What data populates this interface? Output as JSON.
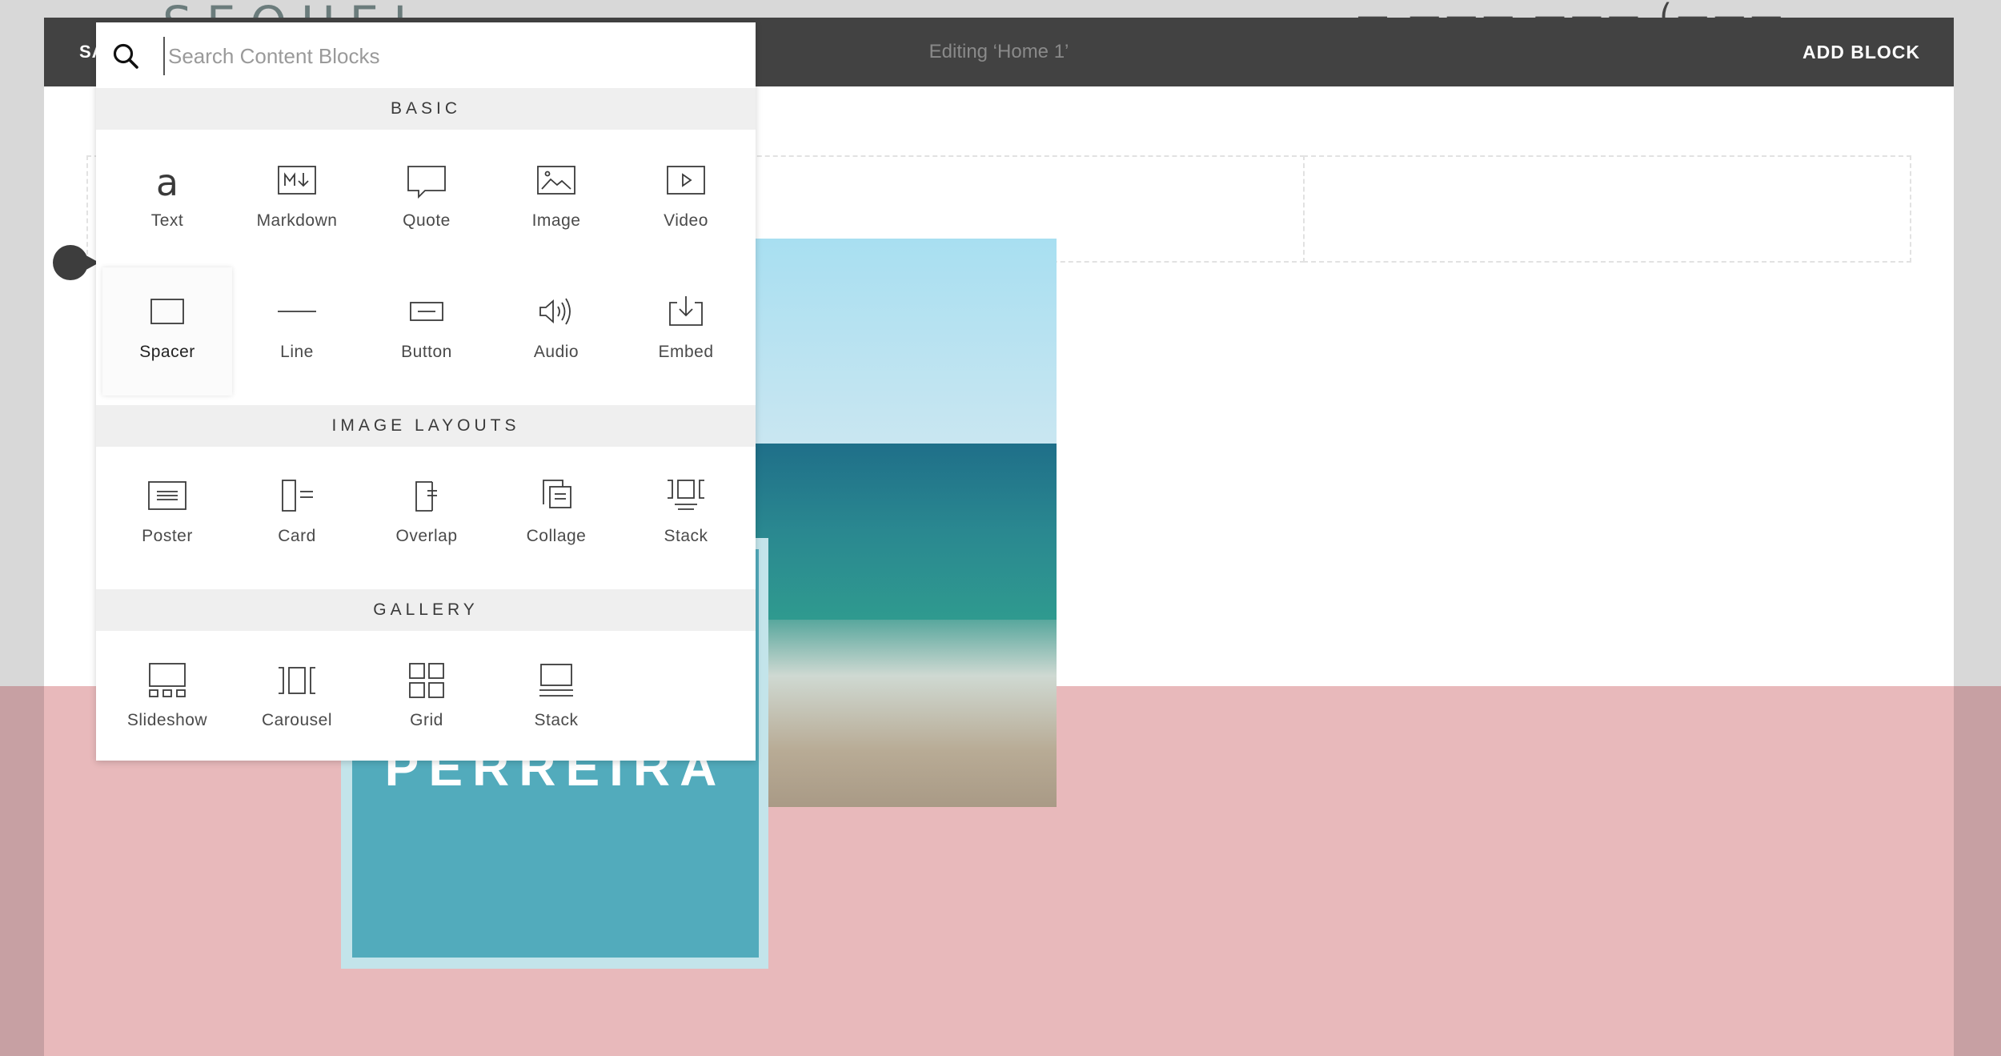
{
  "site": {
    "brand": "SEQUEL",
    "nav_fragment": "— ——— ——— (———"
  },
  "editor": {
    "save_label": "SAVE",
    "editing_label": "Editing ‘Home 1’",
    "add_block_label": "ADD BLOCK"
  },
  "hero": {
    "card_title": "PERREIRA"
  },
  "picker": {
    "search_placeholder": "Search Content Blocks",
    "sections": [
      {
        "title": "BASIC",
        "items": [
          {
            "label": "Text",
            "icon": "text-icon"
          },
          {
            "label": "Markdown",
            "icon": "markdown-icon"
          },
          {
            "label": "Quote",
            "icon": "quote-icon"
          },
          {
            "label": "Image",
            "icon": "image-icon"
          },
          {
            "label": "Video",
            "icon": "video-icon"
          },
          {
            "label": "Spacer",
            "icon": "spacer-icon",
            "selected": true
          },
          {
            "label": "Line",
            "icon": "line-icon"
          },
          {
            "label": "Button",
            "icon": "button-icon"
          },
          {
            "label": "Audio",
            "icon": "audio-icon"
          },
          {
            "label": "Embed",
            "icon": "embed-icon"
          }
        ]
      },
      {
        "title": "IMAGE LAYOUTS",
        "items": [
          {
            "label": "Poster",
            "icon": "poster-icon"
          },
          {
            "label": "Card",
            "icon": "card-icon"
          },
          {
            "label": "Overlap",
            "icon": "overlap-icon"
          },
          {
            "label": "Collage",
            "icon": "collage-icon"
          },
          {
            "label": "Stack",
            "icon": "stack-layout-icon"
          }
        ]
      },
      {
        "title": "GALLERY",
        "items": [
          {
            "label": "Slideshow",
            "icon": "slideshow-icon"
          },
          {
            "label": "Carousel",
            "icon": "carousel-icon"
          },
          {
            "label": "Grid",
            "icon": "grid-icon"
          },
          {
            "label": "Stack",
            "icon": "stack-gallery-icon"
          }
        ]
      }
    ]
  },
  "colors": {
    "editor_bar": "#424242",
    "pink_section": "#e8b9bb",
    "card_teal": "#52abbc"
  }
}
